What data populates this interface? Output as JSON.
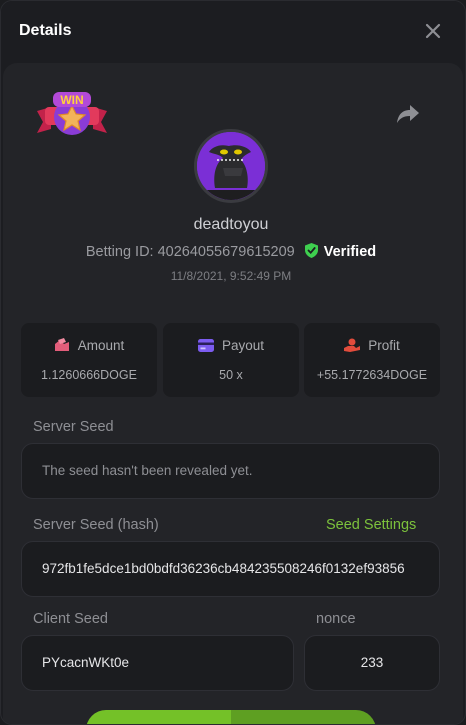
{
  "header": {
    "title": "Details"
  },
  "user": {
    "name": "deadtoyou"
  },
  "bet": {
    "id_label": "Betting ID:",
    "id": "40264055679615209",
    "verified": "Verified",
    "timestamp": "11/8/2021, 9:52:49 PM"
  },
  "badge": {
    "text": "WIN"
  },
  "stats": {
    "amount": {
      "label": "Amount",
      "value": "1.1260666DOGE"
    },
    "payout": {
      "label": "Payout",
      "value": "50 x"
    },
    "profit": {
      "label": "Profit",
      "value": "+55.1772634DOGE"
    }
  },
  "server_seed": {
    "label": "Server Seed",
    "value": "The seed hasn't been revealed yet."
  },
  "server_seed_hash": {
    "label": "Server Seed (hash)",
    "link": "Seed Settings",
    "value": "972fb1fe5dce1bd0bdfd36236cb484235508246f0132ef93856"
  },
  "client_seed": {
    "label": "Client Seed",
    "value": "PYcacnWKt0e"
  },
  "nonce": {
    "label": "nonce",
    "value": "233"
  },
  "colors": {
    "accent": "#7cc23c",
    "verified": "#3ecf4f",
    "amount_icon": "#e25d7a",
    "payout_icon": "#7c5cf0",
    "profit_icon": "#e24c3c"
  }
}
